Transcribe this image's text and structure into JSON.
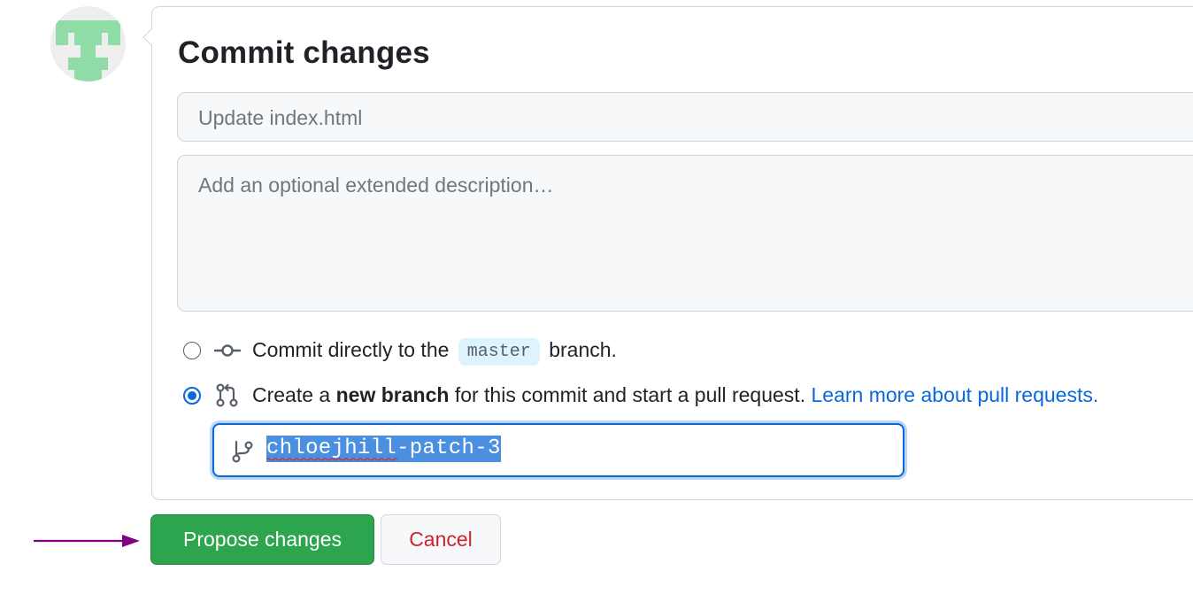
{
  "commit_box": {
    "title": "Commit changes",
    "summary_placeholder": "Update index.html",
    "description_placeholder": "Add an optional extended description…",
    "options": [
      {
        "selected": false,
        "icon": "git-commit-icon",
        "text_before": "Commit directly to the",
        "branch": "master",
        "text_after": "branch."
      },
      {
        "selected": true,
        "icon": "git-pull-request-icon",
        "text_before": "Create a",
        "bold": "new branch",
        "text_after": "for this commit and start a pull request.",
        "link": "Learn more about pull requests."
      }
    ],
    "branch_name": "chloejhill-patch-3",
    "branch_name_selected": true
  },
  "actions": {
    "propose_label": "Propose changes",
    "cancel_label": "Cancel"
  },
  "colors": {
    "primary_button": "#2da44e",
    "cancel_text": "#cf222e",
    "link": "#0969da",
    "selection": "#4a8fe0",
    "annotation_arrow": "#800080",
    "avatar": "#8fdca6"
  }
}
